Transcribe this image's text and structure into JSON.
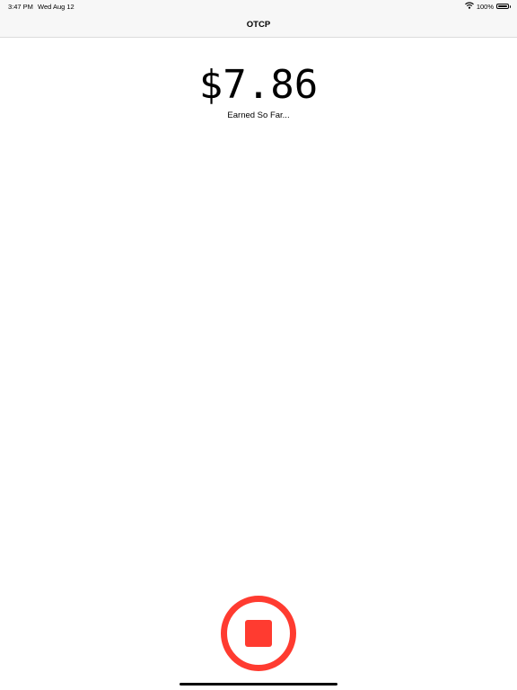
{
  "status_bar": {
    "time": "3:47 PM",
    "date": "Wed Aug 12",
    "battery_text": "100%",
    "battery_level": 1.0,
    "wifi_icon": "wifi-icon",
    "battery_icon": "battery-icon"
  },
  "nav": {
    "title": "OTCP"
  },
  "earnings": {
    "amount": "$7.86",
    "label": "Earned So Far..."
  },
  "controls": {
    "stop_icon": "stop-icon",
    "accent_color": "#ff3b30"
  }
}
